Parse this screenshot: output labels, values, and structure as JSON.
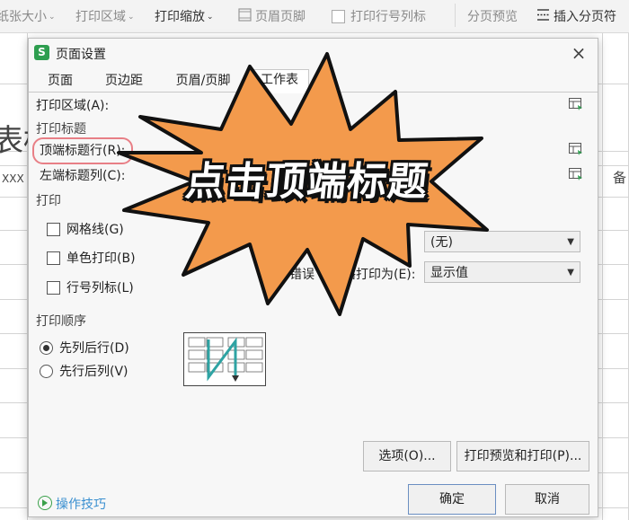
{
  "ribbon": {
    "paper_size": "纸张大小",
    "print_area": "打印区域",
    "print_scale": "打印缩放",
    "header_footer": "页眉页脚",
    "print_row_col_labels": "打印行号列标",
    "page_break_preview": "分页预览",
    "insert_page_break": "插入分页符"
  },
  "background": {
    "partial_title": "表标",
    "cell_text": "XXX",
    "right_header": "备"
  },
  "dialog": {
    "title": "页面设置",
    "app_icon_letter": "S",
    "tabs": [
      {
        "label": "页面"
      },
      {
        "label": "页边距"
      },
      {
        "label": "页眉/页脚"
      },
      {
        "label": "工作表"
      }
    ],
    "active_tab": "工作表",
    "print_area_label": "打印区域(A):",
    "print_titles_section": "打印标题",
    "top_title_rows_label": "顶端标题行(R):",
    "left_title_cols_label": "左端标题列(C):",
    "print_section": "打印",
    "gridlines_label": "网格线(G)",
    "mono_print_label": "单色打印(B)",
    "row_col_labels_label": "行号列标(L)",
    "comments_combo_value": "(无)",
    "errors_label_fragment_1": "错误",
    "errors_label_fragment_2": "格打印为(E):",
    "errors_combo_value": "显示值",
    "print_order_section": "打印顺序",
    "down_then_over_label": "先列后行(D)",
    "over_then_down_label": "先行后列(V)",
    "options_button": "选项(O)...",
    "print_preview_button": "打印预览和打印(P)...",
    "tips_label": "操作技巧",
    "ok_button": "确定",
    "cancel_button": "取消"
  },
  "overlay": {
    "burst_text": "点击顶端标题",
    "burst_color": "#f39a4c"
  }
}
